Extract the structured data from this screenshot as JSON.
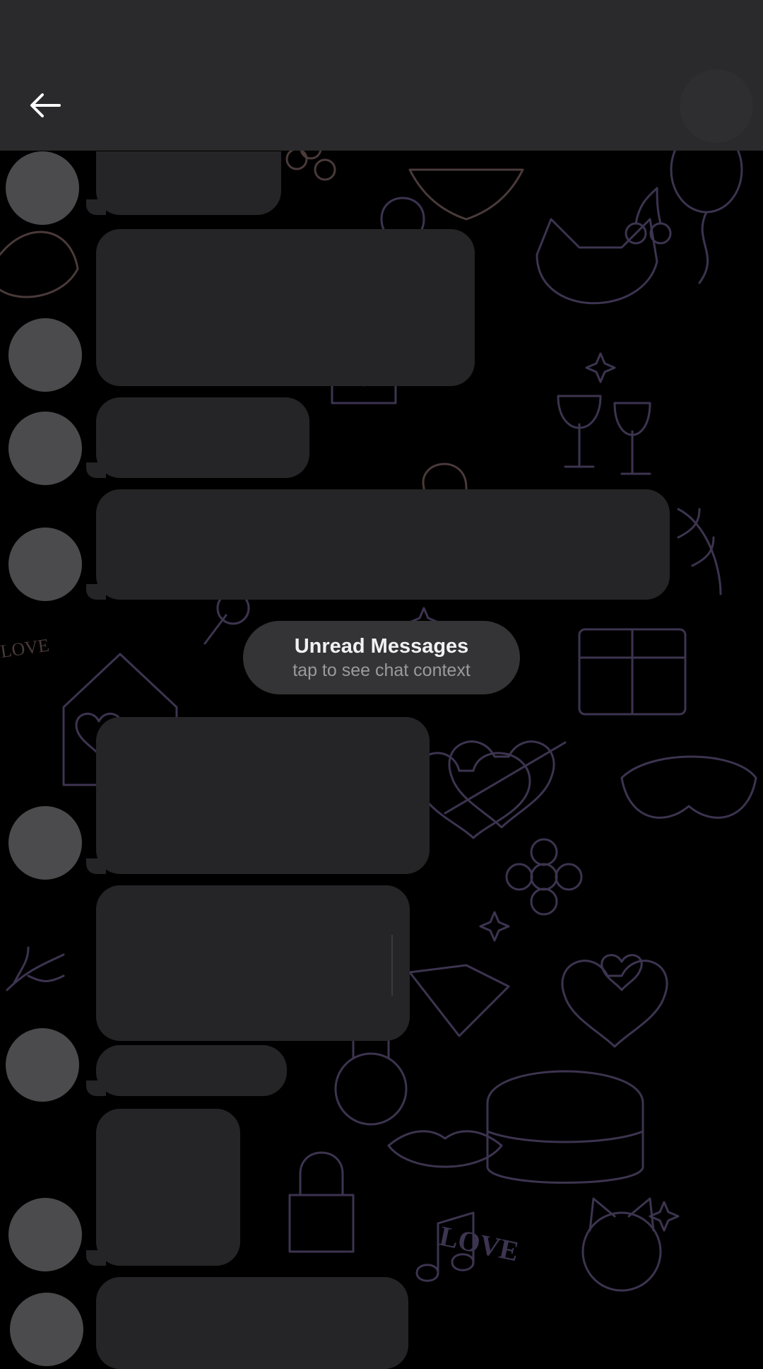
{
  "header": {
    "back_icon": "arrow-left-icon",
    "colors": {
      "topbar": "#2a2a2c",
      "background": "#000000"
    }
  },
  "unread": {
    "title": "Unread Messages",
    "subtitle": "tap to see chat context"
  },
  "wallpaper": {
    "texts": [
      "LOVE",
      "LOVE"
    ],
    "colors": {
      "line": "#3b3256",
      "line_warm": "#4a3a3a"
    }
  },
  "colors": {
    "bubble": "#252527",
    "avatar": "#4b4b4d",
    "pill": "#343436"
  }
}
